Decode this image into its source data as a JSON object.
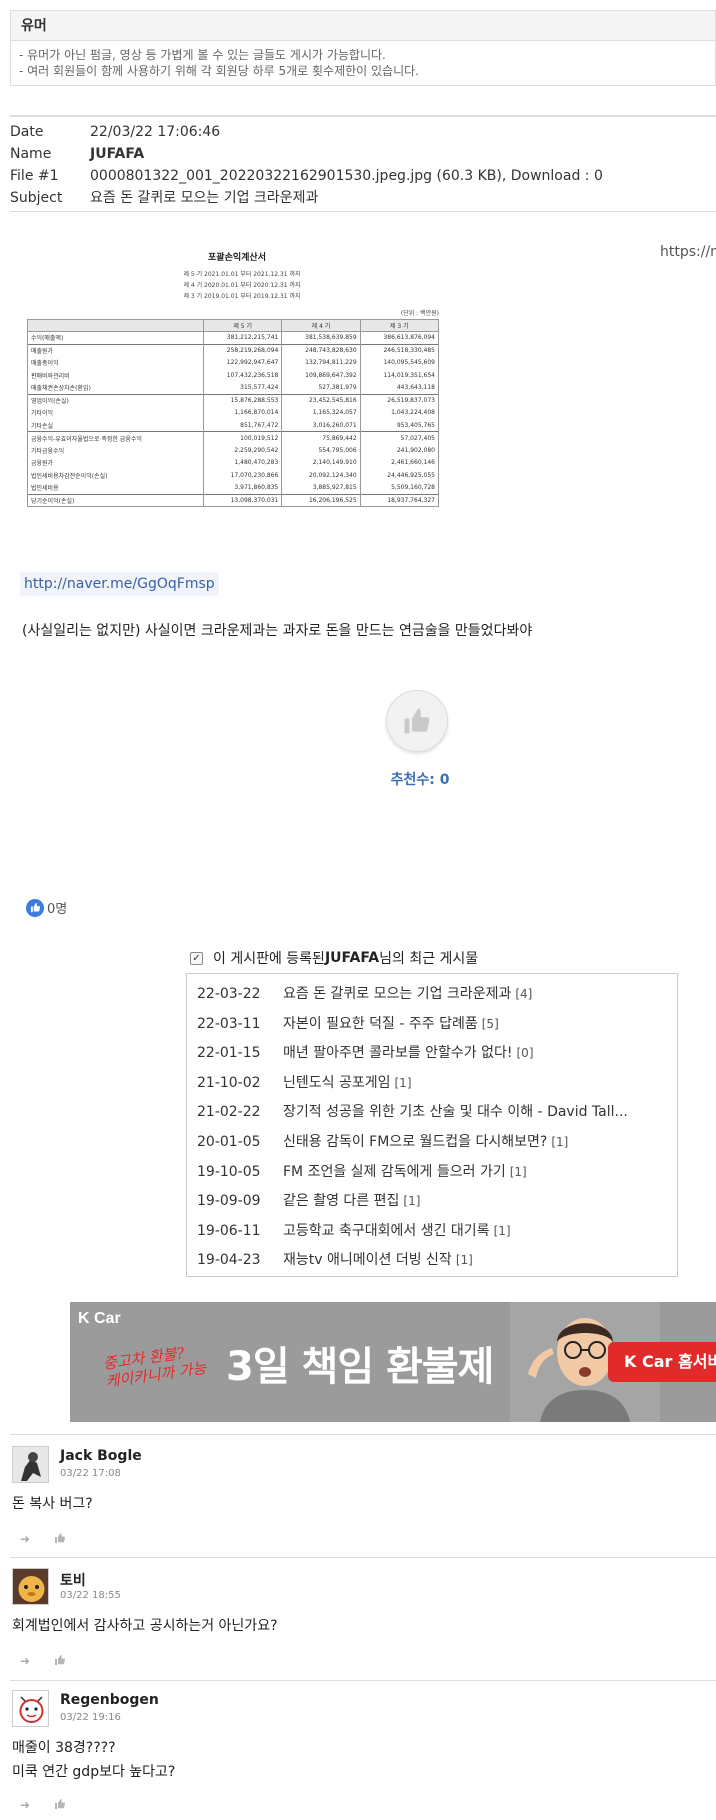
{
  "board": {
    "title": "유머",
    "desc_lines": [
      "- 유머가 아닌 펌글, 영상 등 가볍게 볼 수 있는 글들도 게시가 가능합니다.",
      "- 여러 회원들이 함께 사용하기 위해 각 회원당 하루 5개로 횟수제한이 있습니다."
    ]
  },
  "meta": {
    "date_label": "Date",
    "date_value": "22/03/22 17:06:46",
    "name_label": "Name",
    "name_value": "JUFAFA",
    "file_label": "File #1",
    "file_value": "0000801322_001_20220322162901530.jpeg.jpg (60.3 KB), Download : 0",
    "subject_label": "Subject",
    "subject_value": "요즘 돈 갈퀴로 모으는 기업 크라운제과"
  },
  "post": {
    "ext_url": "https://n",
    "link": "http://naver.me/GgOqFmsp",
    "body": "(사실일리는 없지만) 사실이면 크라운제과는 과자로 돈을 만드는 연금술을 만들었다봐야",
    "recommend_label": "추천수:",
    "recommend_count": "0",
    "likes_text": "0명"
  },
  "statement": {
    "title": "포괄손익계산서",
    "periods": [
      "제 5 기 2021.01.01 부터 2021.12.31 까지",
      "제 4 기 2020.01.01 부터 2020.12.31 까지",
      "제 3 기 2019.01.01 부터 2019.12.31 까지"
    ],
    "unit": "(단위 : 백만원)",
    "columns": [
      "",
      "제 5 기",
      "제 4 기",
      "제 3 기"
    ],
    "rows": [
      [
        "수익(매출액)",
        "381,212,215,741",
        "381,538,639,859",
        "386,613,876,094"
      ],
      [
        "매출원가",
        "258,219,268,094",
        "248,743,828,630",
        "246,518,330,485"
      ],
      [
        "매출총이익",
        "122,992,947,647",
        "132,794,811,229",
        "140,095,545,609"
      ],
      [
        "판매비와관리비",
        "107,432,236,518",
        "109,869,647,392",
        "114,019,351,654"
      ],
      [
        "매출채권손상차손(환입)",
        "315,577,424",
        "527,381,979",
        "443,643,118"
      ],
      [
        "영업이익(손실)",
        "15,876,288,553",
        "23,452,545,816",
        "26,519,837,073"
      ],
      [
        "기타이익",
        "1,166,870,014",
        "1,165,324,057",
        "1,043,224,408"
      ],
      [
        "기타손실",
        "851,767,472",
        "3,016,260,071",
        "953,405,765"
      ],
      [
        "금융수익-유효이자율법으로 측정한 금융수익",
        "100,019,512",
        "75,869,442",
        "57,027,405"
      ],
      [
        "기타금융수익",
        "2,259,290,542",
        "554,795,006",
        "241,902,080"
      ],
      [
        "금융원가",
        "1,480,470,283",
        "2,140,149,910",
        "2,461,660,146"
      ],
      [
        "법인세비용차감전순이익(손실)",
        "17,070,230,866",
        "20,092,124,340",
        "24,446,925,055"
      ],
      [
        "법인세비용",
        "3,971,860,835",
        "3,885,927,815",
        "5,509,160,728"
      ],
      [
        "당기순이익(손실)",
        "13,098,370,031",
        "16,206,196,525",
        "18,937,764,327"
      ]
    ]
  },
  "recent": {
    "head_prefix": "이 게시판에 등록된 ",
    "head_user": "JUFAFA",
    "head_suffix": "님의 최근 게시물",
    "items": [
      {
        "date": "22-03-22",
        "title": "요즘 돈 갈퀴로 모으는 기업 크라운제과",
        "count": "[4]"
      },
      {
        "date": "22-03-11",
        "title": "자본이 필요한 덕질 - 주주 답례품",
        "count": "[5]"
      },
      {
        "date": "22-01-15",
        "title": "매년 팔아주면 콜라보를 안할수가 없다!",
        "count": "[0]"
      },
      {
        "date": "21-10-02",
        "title": "닌텐도식 공포게임",
        "count": "[1]"
      },
      {
        "date": "21-02-22",
        "title": "장기적 성공을 위한 기초 산술 및 대수 이해 - David Tall...",
        "count": ""
      },
      {
        "date": "20-01-05",
        "title": "신태용 감독이 FM으로 월드컵을 다시해보면?",
        "count": "[1]"
      },
      {
        "date": "19-10-05",
        "title": "FM 조언을 실제 감독에게 들으러 가기",
        "count": "[1]"
      },
      {
        "date": "19-09-09",
        "title": "같은 촬영 다른 편집",
        "count": "[1]"
      },
      {
        "date": "19-06-11",
        "title": "고등학교 축구대회에서 생긴 대기록",
        "count": "[1]"
      },
      {
        "date": "19-04-23",
        "title": "재능tv 애니메이션 더빙 신작",
        "count": "[1]"
      }
    ]
  },
  "banner": {
    "logo": "K Car",
    "script_line1": "중고차 환불?",
    "script_line2": "케이카니까 가능",
    "headline": "3일 책임 환불제",
    "cta": "K Car 홈서비"
  },
  "comments": [
    {
      "name": "Jack Bogle",
      "time": "03/22 17:08",
      "text": "돈 복사 버그?"
    },
    {
      "name": "토비",
      "time": "03/22 18:55",
      "text": "회계법인에서 감사하고 공시하는거 아닌가요?"
    },
    {
      "name": "Regenbogen",
      "time": "03/22 19:16",
      "text": "매줄이 38경????\n미쿡 연간 gdp보다 높다고?"
    }
  ],
  "colors": {
    "link": "#3a5fa8",
    "recommend": "#3a6fb8",
    "banner_red": "#e12b2b"
  }
}
